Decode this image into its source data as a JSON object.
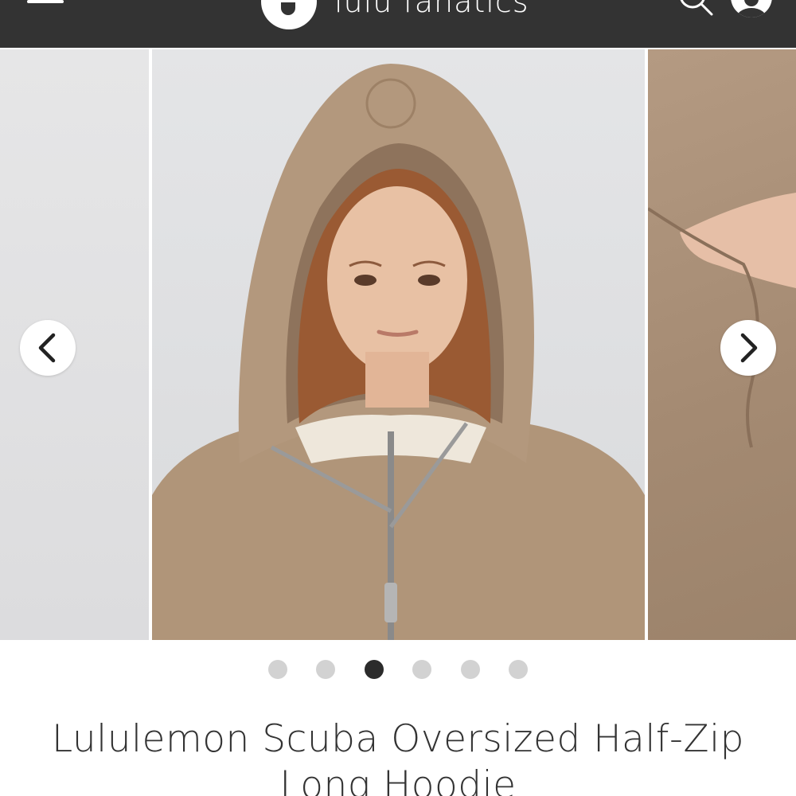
{
  "header": {
    "brand_name": "lulu fanatics",
    "menu_icon": "hamburger-menu-icon",
    "search_icon": "search-icon",
    "profile_icon": "user-profile-icon",
    "background_color": "#333333"
  },
  "carousel": {
    "prev_arrow_icon": "chevron-left-icon",
    "next_arrow_icon": "chevron-right-icon",
    "slide_count": 6,
    "active_index": 2,
    "images": [
      {
        "description_icon": "product-photo-detail"
      },
      {
        "description_icon": "product-photo-model-hooded"
      },
      {
        "description_icon": "product-photo-pocket-detail"
      }
    ]
  },
  "product": {
    "title": "Lululemon Scuba Oversized Half-Zip Long Hoodie",
    "color": "#a88d75"
  }
}
